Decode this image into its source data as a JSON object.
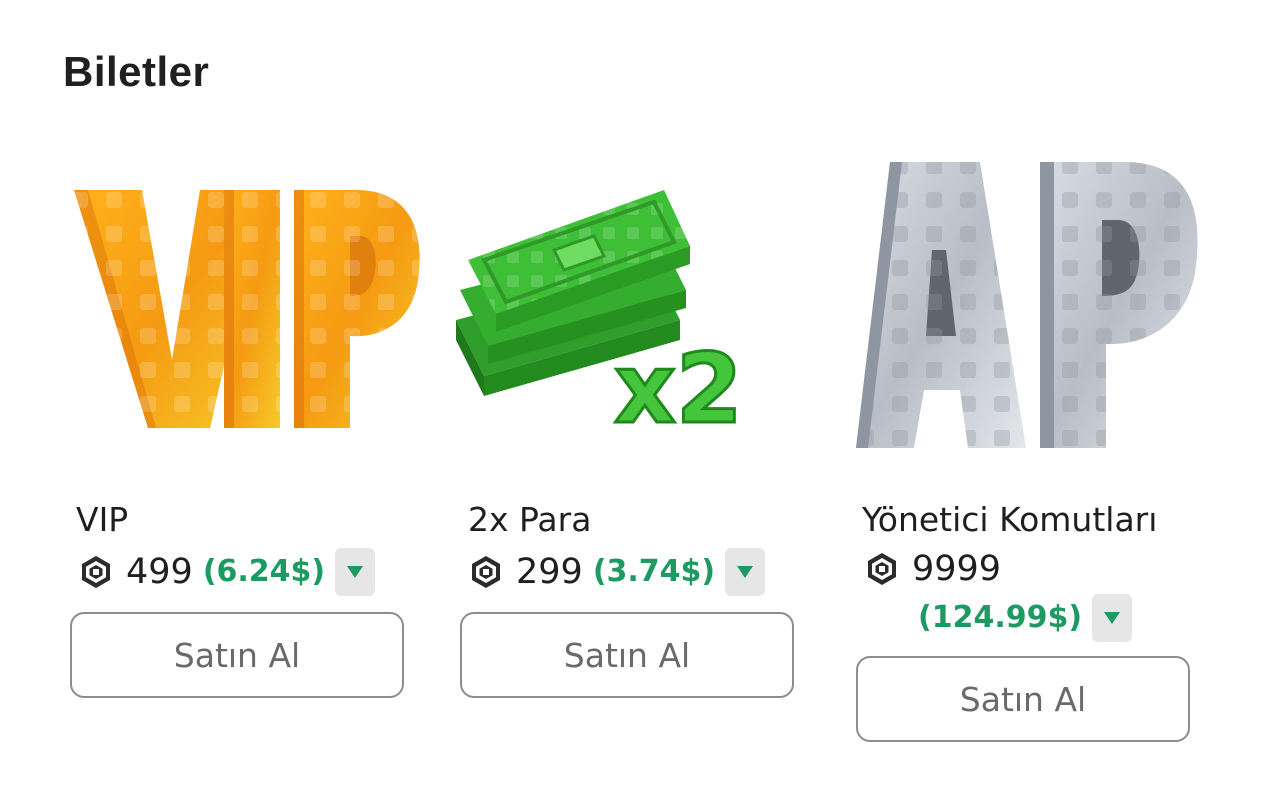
{
  "section": {
    "title": "Biletler"
  },
  "colors": {
    "usd_green": "#1d9a61",
    "button_border": "#8d8d8d",
    "caret_bg": "#e6e6e6"
  },
  "items": [
    {
      "name": "VIP",
      "price": "499",
      "usd": "(6.24$)",
      "buy_label": "Satın Al",
      "image_text": "VIP",
      "icon": "vip-gold-letters"
    },
    {
      "name": "2x Para",
      "price": "299",
      "usd": "(3.74$)",
      "buy_label": "Satın Al",
      "image_text": "x2",
      "icon": "green-cash-stack"
    },
    {
      "name": "Yönetici Komutları",
      "price": "9999",
      "usd": "(124.99$)",
      "buy_label": "Satın Al",
      "image_text": "AP",
      "icon": "silver-ap-letters"
    }
  ],
  "currency_icon": "robux-icon",
  "dropdown_icon": "caret-down-icon"
}
